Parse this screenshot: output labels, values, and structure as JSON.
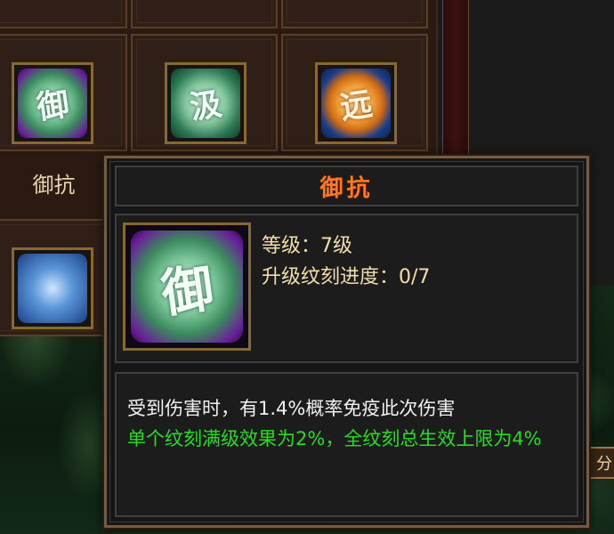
{
  "grid": {
    "labels_top": [
      "",
      "",
      ""
    ],
    "slots": [
      {
        "label": "御抗",
        "glyph": "御"
      },
      {
        "label": "",
        "glyph": "汲"
      },
      {
        "label": "",
        "glyph": "远"
      }
    ]
  },
  "tooltip": {
    "title": "御抗",
    "icon_glyph": "御",
    "level_text": "等级：7级",
    "progress_text": "升级纹刻进度：0/7",
    "description": "受到伤害时，有1.4%概率免疫此次伤害",
    "bonus_text": "单个纹刻满级效果为2%，全纹刻总生效上限为4%"
  },
  "edge_button": {
    "label": "分"
  },
  "colors": {
    "title": "#ff7a1e",
    "info_text": "#f3dfa8",
    "bonus_text": "#22e01e",
    "frame": "#7a5a38"
  },
  "icons": [
    "jade-token-icon",
    "jade-token-icon",
    "orange-medallion-icon"
  ]
}
